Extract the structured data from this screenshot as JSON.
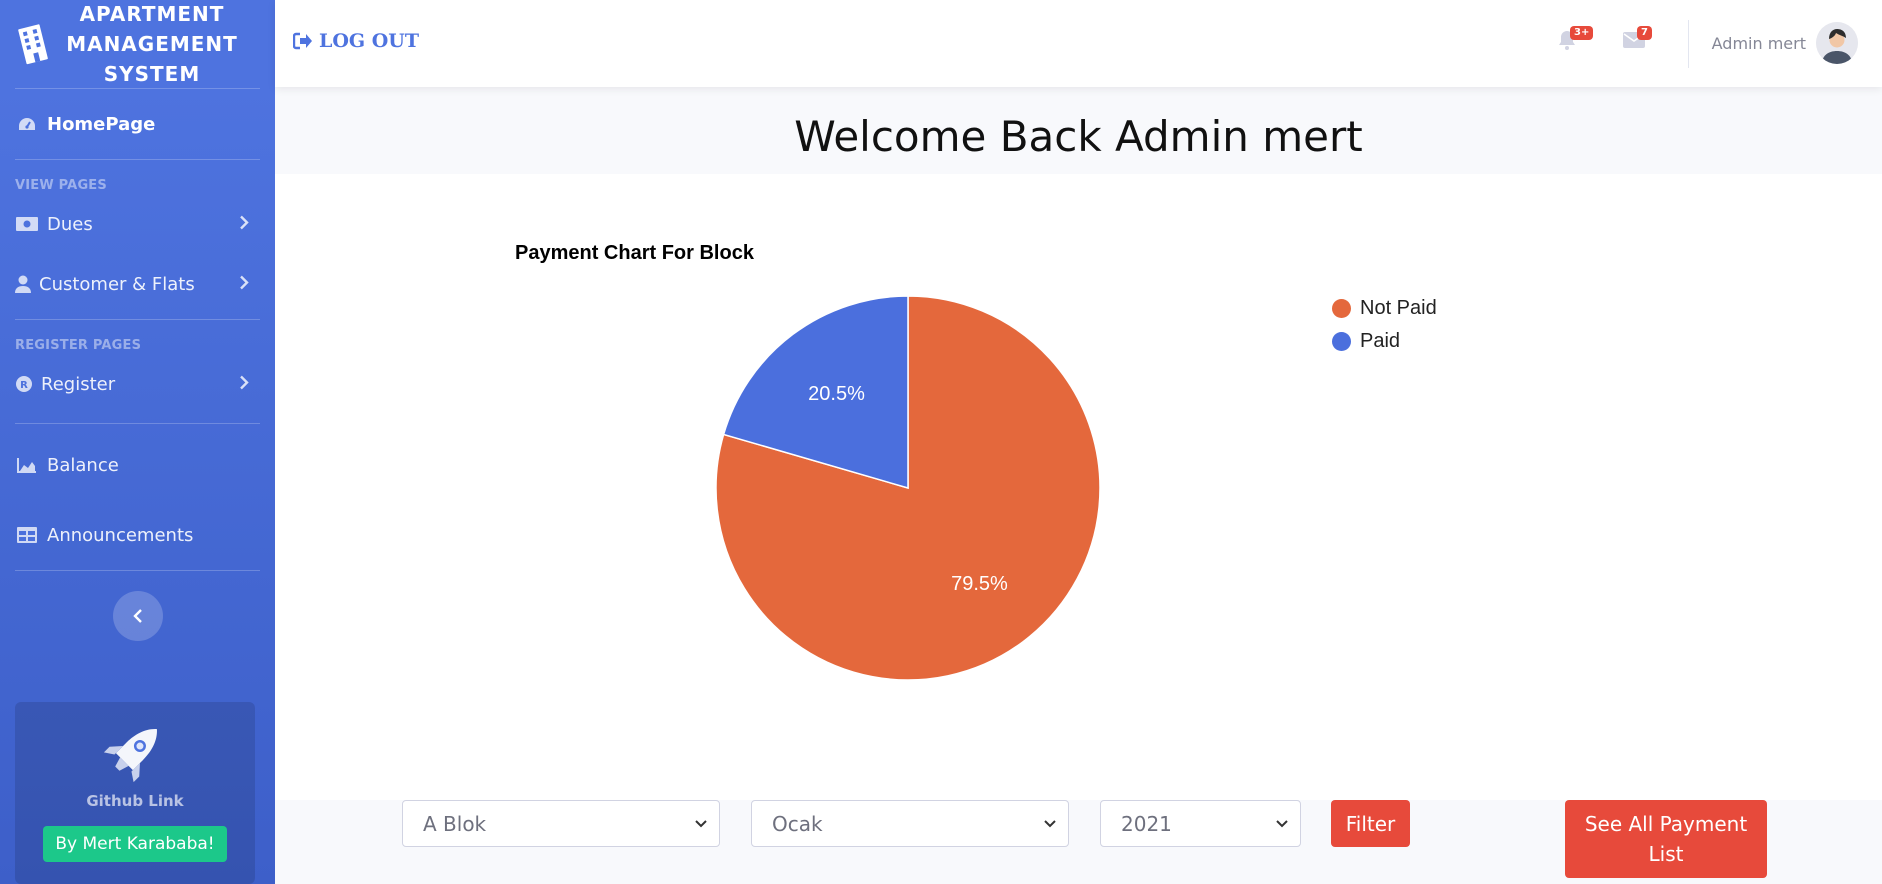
{
  "sidebar": {
    "brand": "APARTMENT MANAGEMENT SYSTEM",
    "home": "HomePage",
    "section_view": "VIEW PAGES",
    "dues": "Dues",
    "customer": "Customer & Flats",
    "section_register": "REGISTER PAGES",
    "register": "Register",
    "balance": "Balance",
    "announcements": "Announcements",
    "promo_title": "Github Link",
    "promo_button": "By Mert Karababa!"
  },
  "topbar": {
    "logout": "LOG OUT",
    "alerts_badge": "3+",
    "messages_badge": "7",
    "user_name": "Admin mert"
  },
  "main": {
    "welcome": "Welcome Back Admin mert"
  },
  "chart_data": {
    "type": "pie",
    "title": "Payment Chart For Block",
    "categories": [
      "Not Paid",
      "Paid"
    ],
    "values": [
      79.5,
      20.5
    ],
    "labels": [
      "79.5%",
      "20.5%"
    ],
    "colors": [
      "#e4683c",
      "#4b6fdd"
    ],
    "legend": "top-right"
  },
  "filters": {
    "block": "A Blok",
    "month": "Ocak",
    "year": "2021",
    "filter_button": "Filter",
    "see_all_button": "See All Payment List"
  },
  "colors": {
    "sidebar": "#4e73df",
    "accent": "#4e73df",
    "danger": "#e74a3b",
    "success": "#1cc88a"
  }
}
